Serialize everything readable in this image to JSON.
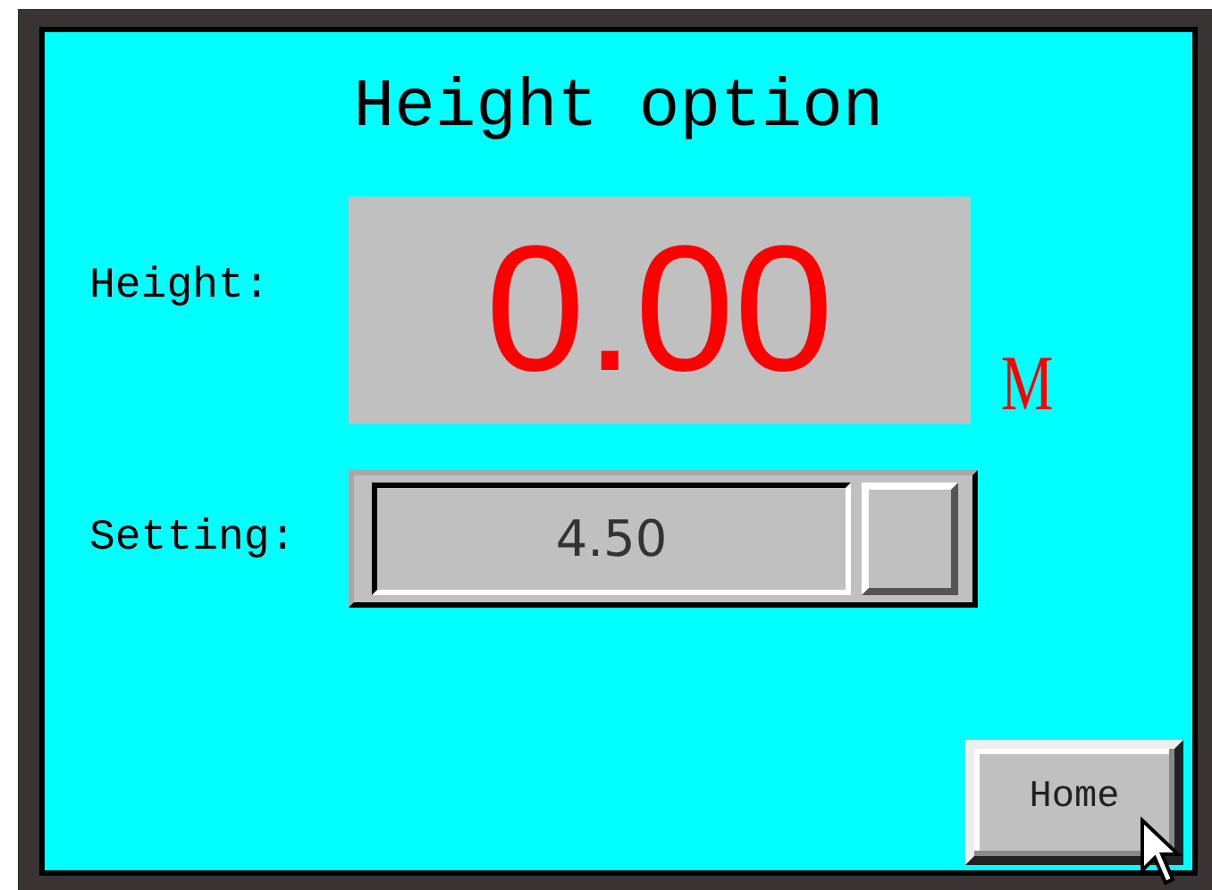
{
  "title": "Height option",
  "height": {
    "label": "Height:",
    "value": "0.00",
    "unit": "M"
  },
  "setting": {
    "label": "Setting:",
    "value": "4.50"
  },
  "home_button": {
    "label": "Home"
  }
}
